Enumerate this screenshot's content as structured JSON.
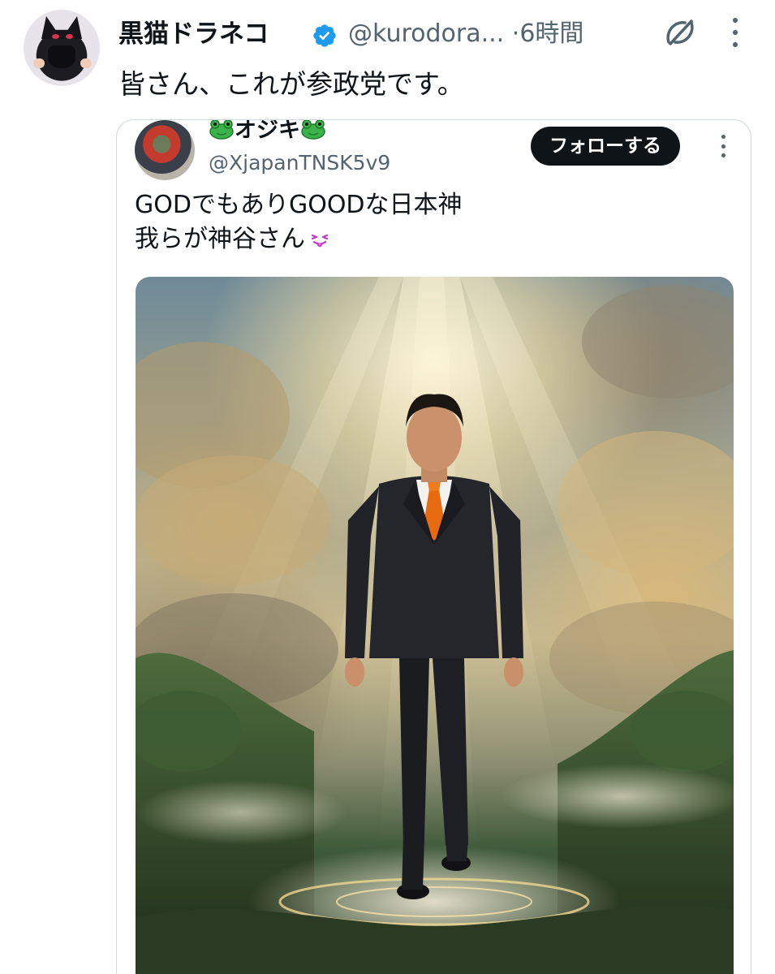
{
  "tweet": {
    "author_name": "黒猫ドラネコ",
    "author_handle": "@kurodora...",
    "separator": "·",
    "time_ago": "6時間",
    "text": "皆さん、これが参政党です。"
  },
  "quoted_tweet": {
    "author_name_prefix_icon": "frog-emoji",
    "author_name": "オジキ",
    "author_name_suffix_icon": "frog-emoji",
    "author_handle": "@XjapanTNSK5v9",
    "follow_label": "フォローする",
    "text_line1": "GODでもありGOODな日本神",
    "text_line2": "我らが神谷さん",
    "text_emoji": "face-with-stuck-out-tongue-and-tightly-closed-eyes-emoji",
    "media": "image-of-man-in-suit-walking-under-light-rays"
  },
  "icons": {
    "verified": "verified-badge-icon",
    "grok": "grok-icon",
    "more": "more-options-icon"
  },
  "colors": {
    "verified_blue": "#1d9bf0",
    "follow_button_bg": "#0f1419",
    "secondary_text": "#536471",
    "tie_orange": "#e86a10"
  }
}
